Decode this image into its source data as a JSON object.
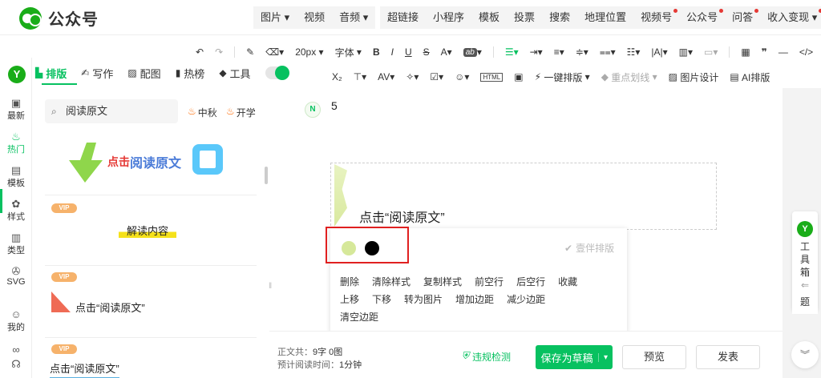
{
  "app": {
    "name": "公众号"
  },
  "topmenu": {
    "group1": [
      "图片",
      "视频",
      "音频"
    ],
    "group2": [
      "超链接",
      "小程序",
      "模板",
      "投票",
      "搜索",
      "地理位置",
      "视频号",
      "公众号",
      "问答",
      "收入变现"
    ]
  },
  "toolbar1": {
    "font_size": "20px",
    "font_family": "字体"
  },
  "toolbar2": {
    "one_click": "一键排版",
    "highlight": "重点划线",
    "image_design": "图片设计",
    "ai_layout": "AI排版"
  },
  "rail": {
    "logo": "Y",
    "items": [
      "最新",
      "热门",
      "模板",
      "样式",
      "类型",
      "SVG",
      "我的"
    ]
  },
  "tabs": [
    "排版",
    "写作",
    "配图",
    "热榜",
    "工具"
  ],
  "panel": {
    "search": "阅读原文",
    "hot_tags": [
      "中秋",
      "开学"
    ],
    "vip": "VIP",
    "cards": [
      {
        "text_red": "点击",
        "text_blue": "阅读原文"
      },
      {
        "text": "解读内容"
      },
      {
        "text": "点击“阅读原文”"
      },
      {
        "text": "点击“阅读原文”"
      }
    ]
  },
  "editor": {
    "avatar": "N",
    "number": "5",
    "block_title": "点击“阅读原文”",
    "swatches": [
      "#d6e89a",
      "#000000"
    ],
    "brand_watermark": "壹伴排版",
    "actions_row1": [
      "删除",
      "清除样式",
      "复制样式",
      "前空行",
      "后空行",
      "收藏"
    ],
    "actions_row2": [
      "上移",
      "下移",
      "转为图片",
      "增加边距",
      "减少边距"
    ],
    "actions_row3": [
      "清空边距"
    ]
  },
  "toolbox": {
    "logo": "Y",
    "chars": [
      "工",
      "具",
      "箱"
    ],
    "second": "题"
  },
  "footer": {
    "word_count_label": "正文共：",
    "word_count": "9字 0图",
    "read_time_label": "预计阅读时间：",
    "read_time": "1分钟",
    "check": "违规检测",
    "save": "保存为草稿",
    "preview": "预览",
    "publish": "发表"
  },
  "colors": {
    "accent": "#07c160",
    "brand": "#1aad19",
    "highlight_box": "#e02020"
  }
}
